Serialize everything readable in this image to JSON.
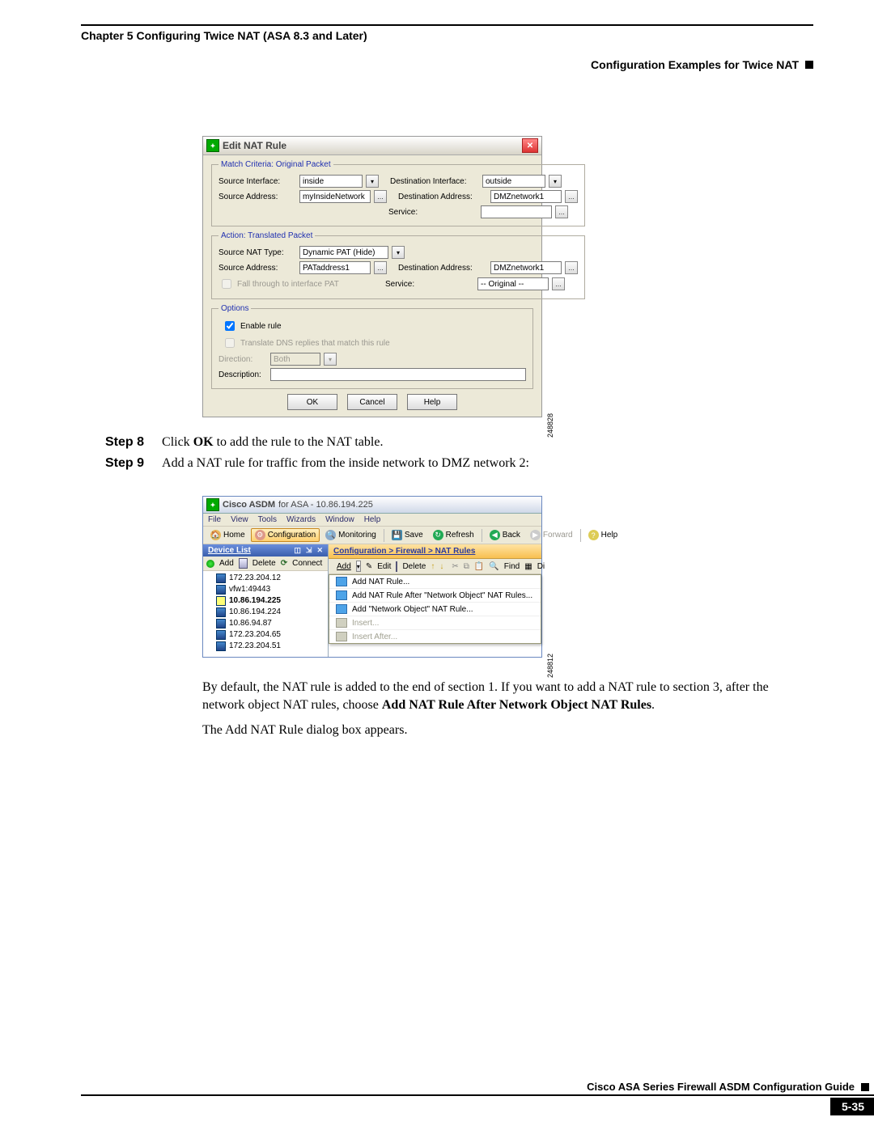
{
  "header": {
    "chapter": "Chapter 5    Configuring Twice NAT (ASA 8.3 and Later)",
    "section": "Configuration Examples for Twice NAT"
  },
  "dialog": {
    "title": "Edit NAT Rule",
    "groups": {
      "match": {
        "legend": "Match Criteria: Original Packet",
        "src_if_label": "Source Interface:",
        "src_if_value": "inside",
        "dst_if_label": "Destination Interface:",
        "dst_if_value": "outside",
        "src_addr_label": "Source Address:",
        "src_addr_value": "myInsideNetwork",
        "dst_addr_label": "Destination Address:",
        "dst_addr_value": "DMZnetwork1",
        "service_label": "Service:",
        "service_value": ""
      },
      "action": {
        "legend": "Action: Translated Packet",
        "nat_type_label": "Source NAT Type:",
        "nat_type_value": "Dynamic PAT (Hide)",
        "src_addr_label": "Source Address:",
        "src_addr_value": "PATaddress1",
        "dst_addr_label": "Destination Address:",
        "dst_addr_value": "DMZnetwork1",
        "fall_through": "Fall through to interface PAT",
        "service_label": "Service:",
        "service_value": "-- Original --"
      },
      "options": {
        "legend": "Options",
        "enable": "Enable rule",
        "translate_dns": "Translate DNS replies that match this rule",
        "direction_label": "Direction:",
        "direction_value": "Both",
        "description_label": "Description:"
      }
    },
    "buttons": {
      "ok": "OK",
      "cancel": "Cancel",
      "help": "Help"
    },
    "fig_id": "248828"
  },
  "steps": {
    "s8_label": "Step 8",
    "s8_pre": "Click ",
    "s8_bold": "OK",
    "s8_post": " to add the rule to the NAT table.",
    "s9_label": "Step 9",
    "s9_text": "Add a NAT rule for traffic from the inside network to DMZ network 2:"
  },
  "asdm": {
    "title_prefix": "Cisco ASDM",
    "title_for": " for ASA - 10.86.194.225",
    "menu": [
      "File",
      "View",
      "Tools",
      "Wizards",
      "Window",
      "Help"
    ],
    "toolbar": {
      "home": "Home",
      "config": "Configuration",
      "monitor": "Monitoring",
      "save": "Save",
      "refresh": "Refresh",
      "back": "Back",
      "forward": "Forward",
      "help": "Help"
    },
    "sidebar": {
      "header": "Device List",
      "add": "Add",
      "delete": "Delete",
      "connect": "Connect",
      "items": [
        "172.23.204.12",
        "vfw1:49443",
        "10.86.194.225",
        "10.86.194.224",
        "10.86.94.87",
        "172.23.204.65",
        "172.23.204.51"
      ]
    },
    "breadcrumb": "Configuration > Firewall > NAT Rules",
    "main_tools": {
      "add": "Add",
      "edit": "Edit",
      "delete": "Delete",
      "find": "Find",
      "dia_short": "Di"
    },
    "dropdown": {
      "add_nat": "Add NAT Rule...",
      "after_obj": "Add NAT Rule After \"Network Object\" NAT Rules...",
      "add_obj": "Add \"Network Object\" NAT Rule...",
      "insert": "Insert...",
      "insert_after": "Insert After..."
    },
    "fig_id": "248812"
  },
  "body": {
    "p1a": "By default, the NAT rule is added to the end of section 1. If you want to add a NAT rule to section 3, after the network object NAT rules, choose ",
    "p1b": "Add NAT Rule After Network Object NAT Rules",
    "p1c": ".",
    "p2": "The Add NAT Rule dialog box appears."
  },
  "footer": {
    "guide": "Cisco ASA Series Firewall ASDM Configuration Guide",
    "page": "5-35"
  }
}
